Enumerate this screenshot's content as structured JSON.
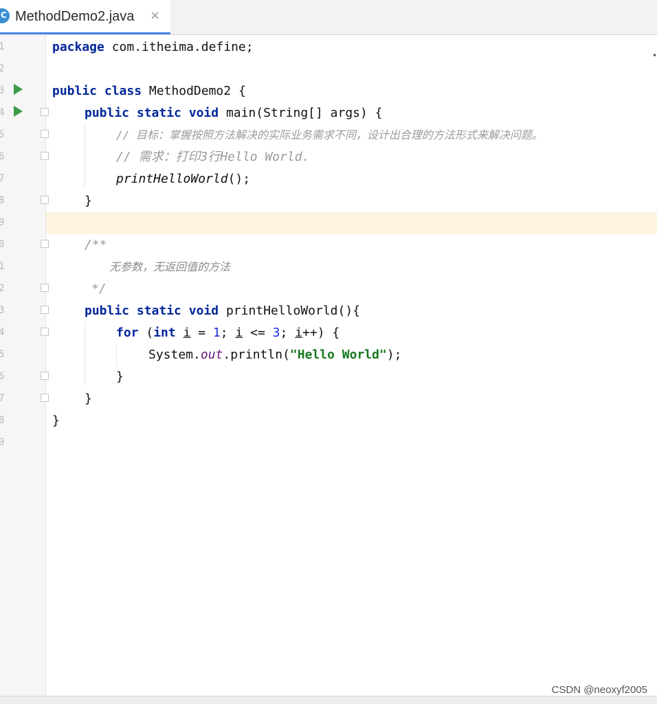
{
  "tab": {
    "filename": "MethodDemo2.java",
    "close": "×",
    "file_icon": "java-class-icon"
  },
  "gutter": {
    "line_numbers": [
      "1",
      "2",
      "3",
      "4",
      "5",
      "6",
      "7",
      "8",
      "9",
      "0",
      "1",
      "2",
      "3",
      "4",
      "5",
      "6",
      "7",
      "8",
      "9"
    ],
    "run_lines": [
      3,
      4
    ]
  },
  "code": {
    "package_kw": "package",
    "package_name": " com.itheima.define;",
    "public_kw": "public",
    "class_kw": "class",
    "class_name": " MethodDemo2 {",
    "static_kw": "static",
    "void_kw": "void",
    "main_sig": " main(String[] args) {",
    "comment_goal": "// 目标：掌握按照方法解决的实际业务需求不同，设计出合理的方法形式来解决问题。",
    "comment_req": "// 需求：打印3行Hello World.",
    "call_stmt": "printHelloWorld",
    "call_tail": "();",
    "close_brace": "}",
    "doc_open": "/**",
    "doc_body": "无参数，无返回值的方法",
    "doc_close": "*/",
    "method_sig": " printHelloWorld(){",
    "for_kw": "for",
    "int_kw": "int",
    "loop_var": "i",
    "loop_eq": " = ",
    "loop_one": "1",
    "loop_sep": "; ",
    "loop_lte": " <= ",
    "loop_three": "3",
    "loop_inc_tail": "++) {",
    "sysout_a": "System.",
    "sysout_out": "out",
    "sysout_b": ".println(",
    "hello_str": "\"Hello World\"",
    "sysout_c": ");"
  },
  "watermark": "CSDN @neoxyf2005",
  "colors": {
    "keyword": "#00269a",
    "string": "#16781e",
    "number": "#1730e0",
    "comment": "#9a9a9a",
    "field": "#6a167c",
    "current_line": "#fdf5e0",
    "run": "#3e9b48"
  }
}
